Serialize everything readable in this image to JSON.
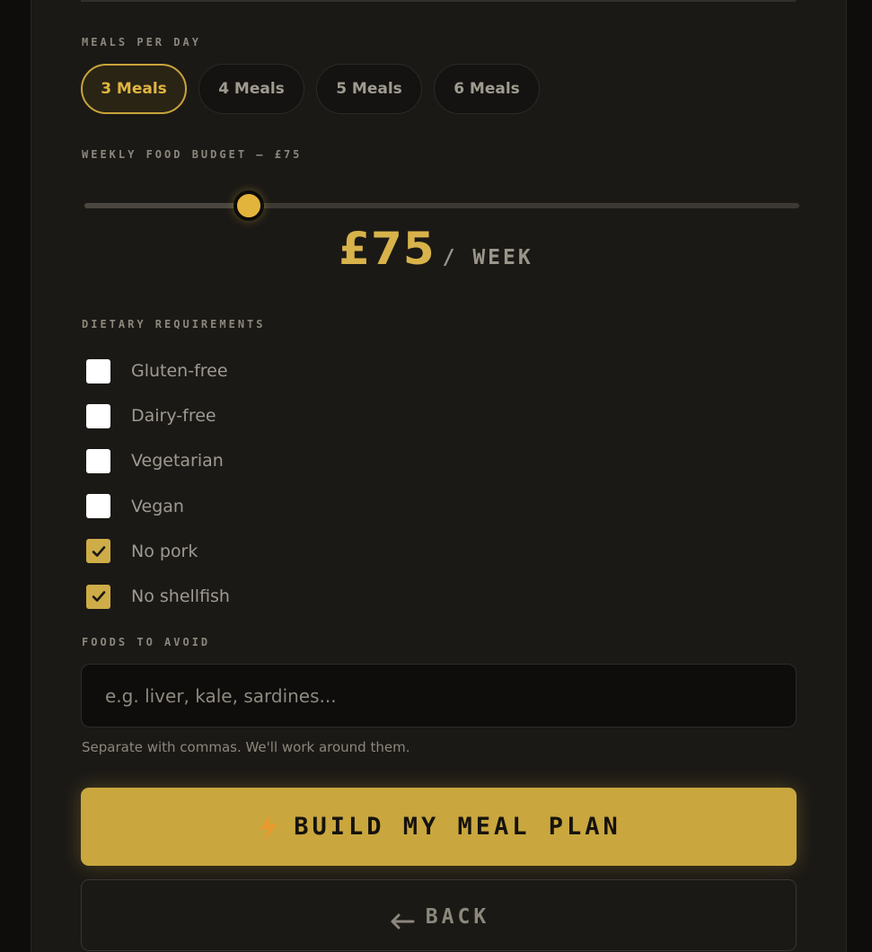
{
  "meals": {
    "label": "MEALS PER DAY",
    "options": [
      "3 Meals",
      "4 Meals",
      "5 Meals",
      "6 Meals"
    ],
    "selected": "3 Meals"
  },
  "budget": {
    "label": "WEEKLY FOOD BUDGET — £75",
    "amount": "£75",
    "unit": "/ WEEK",
    "slider_value": 0.23
  },
  "diet": {
    "label": "DIETARY REQUIREMENTS",
    "items": [
      {
        "label": "Gluten-free",
        "checked": false
      },
      {
        "label": "Dairy-free",
        "checked": false
      },
      {
        "label": "Vegetarian",
        "checked": false
      },
      {
        "label": "Vegan",
        "checked": false
      },
      {
        "label": "No pork",
        "checked": true
      },
      {
        "label": "No shellfish",
        "checked": true
      }
    ]
  },
  "avoid": {
    "label": "FOODS TO AVOID",
    "placeholder": "e.g. liver, kale, sardines...",
    "value": "",
    "hint": "Separate with commas. We'll work around them."
  },
  "actions": {
    "build_label": "BUILD MY MEAL PLAN",
    "build_icon": "lightning-bolt-icon",
    "back_label": "BACK",
    "back_icon": "arrow-left-icon"
  },
  "colors": {
    "accent": "#c9a73e",
    "background": "#1b1916",
    "checked": "#ceac47"
  }
}
